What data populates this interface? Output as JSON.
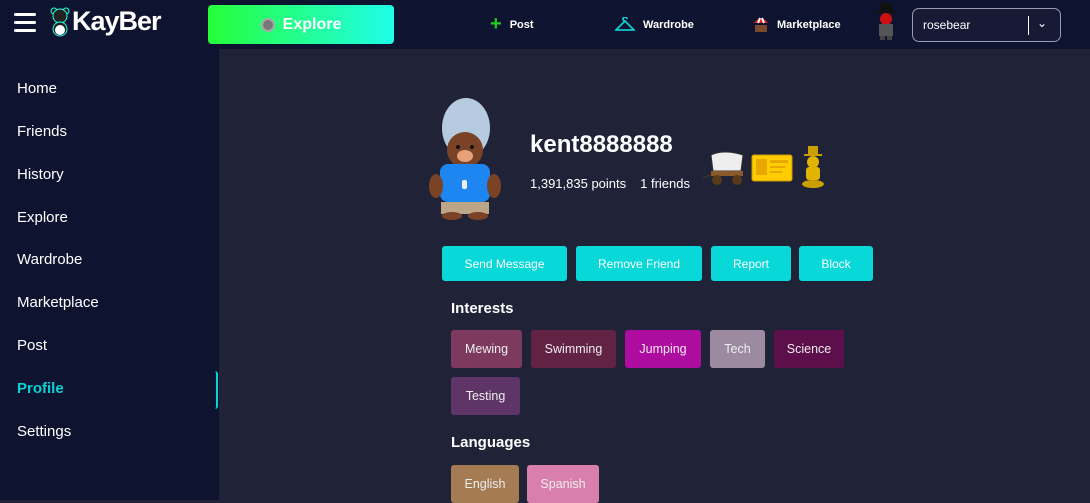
{
  "header": {
    "logo": "KayBer",
    "explore": "Explore",
    "post": "Post",
    "wardrobe": "Wardrobe",
    "marketplace": "Marketplace",
    "user_select": "rosebear"
  },
  "sidebar": {
    "items": [
      {
        "label": "Home"
      },
      {
        "label": "Friends"
      },
      {
        "label": "History"
      },
      {
        "label": "Explore"
      },
      {
        "label": "Wardrobe"
      },
      {
        "label": "Marketplace"
      },
      {
        "label": "Post"
      },
      {
        "label": "Profile"
      },
      {
        "label": "Settings"
      }
    ],
    "active": "Profile"
  },
  "profile": {
    "username": "kent8888888",
    "points": "1,391,835 points",
    "friends": "1 friends",
    "actions": {
      "send_message": "Send Message",
      "remove_friend": "Remove Friend",
      "report": "Report",
      "block": "Block"
    },
    "interests_title": "Interests",
    "interests": [
      {
        "label": "Mewing",
        "color": "#7d3a5e"
      },
      {
        "label": "Swimming",
        "color": "#622244"
      },
      {
        "label": "Jumping",
        "color": "#ad0c9e"
      },
      {
        "label": "Tech",
        "color": "#9b8aa0"
      },
      {
        "label": "Science",
        "color": "#5d0f4b"
      },
      {
        "label": "Testing",
        "color": "#5e3566"
      }
    ],
    "languages_title": "Languages",
    "languages": [
      {
        "label": "English",
        "color": "#a47b53"
      },
      {
        "label": "Spanish",
        "color": "#d97fad"
      }
    ]
  },
  "colors": {
    "accent": "#08d8d8",
    "bg": "#202237",
    "nav": "#0e1330"
  }
}
